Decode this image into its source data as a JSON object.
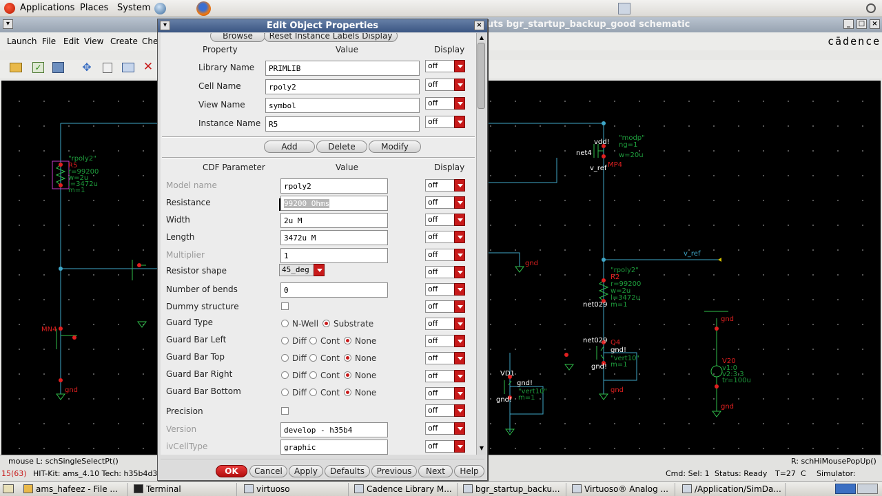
{
  "top_panel": {
    "applications": "Applications",
    "places": "Places",
    "system": "System"
  },
  "schematic_window": {
    "title": "uts bgr_startup_backup_good schematic",
    "menus": [
      "Launch",
      "File",
      "Edit",
      "View",
      "Create",
      "Che"
    ],
    "brand": "cādence",
    "status_left": "mouse L: schSingleSelectPt()",
    "status_right": "R: schHiMouseP­opUp()",
    "status_cmd_count": "15(63)",
    "status_hitkit": "HIT-Kit: ams_4.10  Tech: h35b4d3",
    "status_cmd": "Cmd: Sel: 1",
    "status_ready": "Status: Ready",
    "status_temp": "T=27",
    "status_c": "C",
    "status_sim": "Simulator: spectre"
  },
  "schematic_labels": [
    "\"rpoly2\"",
    "R5",
    "r=99200",
    "w=2u",
    "l=3472u",
    "m=1",
    "\"modp\"",
    "ng=1",
    "vdd!",
    "net4",
    "v_ref",
    "MP4",
    "w=20u",
    "v_ref",
    "\"rpoly2\"",
    "R2",
    "r=99200",
    "w=2u",
    "l=3472u",
    "m=1",
    "net029",
    "net029",
    "Q4",
    "gnd!",
    "\"vert10\"",
    "m=1",
    "gnd!",
    "VD1",
    "gnd!",
    "\"vert10\"",
    "m=1",
    "gnd!",
    "V20",
    "v1:0",
    "v2:3.3",
    "tr=100u",
    "gnd",
    "gnd",
    "gnd",
    "gnd",
    "MN4",
    "gnd"
  ],
  "dialog": {
    "title": "Edit Object Properties",
    "top_buttons": {
      "browse": "Browse",
      "reset": "Reset Instance Labels Display"
    },
    "headers": {
      "property": "Property",
      "value": "Value",
      "display": "Display",
      "cdf": "CDF Parameter"
    },
    "props": [
      {
        "label": "Library Name",
        "value": "PRIMLIB",
        "display": "off"
      },
      {
        "label": "Cell Name",
        "value": "rpoly2",
        "display": "off"
      },
      {
        "label": "View Name",
        "value": "symbol",
        "display": "off"
      },
      {
        "label": "Instance Name",
        "value": "R5",
        "display": "off"
      }
    ],
    "mid_buttons": {
      "add": "Add",
      "delete": "Delete",
      "modify": "Modify"
    },
    "cdf": [
      {
        "label": "Model name",
        "value": "rpoly2",
        "display": "off"
      },
      {
        "label": "Resistance",
        "value": "99200 Ohms",
        "display": "off"
      },
      {
        "label": "Width",
        "value": "2u M",
        "display": "off"
      },
      {
        "label": "Length",
        "value": "3472u M",
        "display": "off"
      },
      {
        "label": "Multiplier",
        "value": "1",
        "display": "off"
      },
      {
        "label": "Resistor shape",
        "value": "45_deg",
        "display": "off"
      },
      {
        "label": "Number of bends",
        "value": "0",
        "display": "off"
      },
      {
        "label": "Dummy structure",
        "value": "",
        "display": "off"
      },
      {
        "label": "Guard Type",
        "value": "",
        "display": "off"
      },
      {
        "label": "Guard Bar Left",
        "value": "",
        "display": "off"
      },
      {
        "label": "Guard Bar Top",
        "value": "",
        "display": "off"
      },
      {
        "label": "Guard Bar Right",
        "value": "",
        "display": "off"
      },
      {
        "label": "Guard Bar Bottom",
        "value": "",
        "display": "off"
      },
      {
        "label": "Precision",
        "value": "",
        "display": "off"
      },
      {
        "label": "Version",
        "value": "develop - h35b4",
        "display": "off"
      },
      {
        "label": "ivCellType",
        "value": "graphic",
        "display": "off"
      }
    ],
    "guard_type_opts": {
      "nwell": "N-Well",
      "substrate": "Substrate"
    },
    "guard_opts": {
      "diff": "Diff",
      "cont": "Cont",
      "none": "None"
    },
    "bottom_buttons": {
      "ok": "OK",
      "cancel": "Cancel",
      "apply": "Apply",
      "defaults": "Defaults",
      "previous": "Previous",
      "next": "Next",
      "help": "Help"
    }
  },
  "taskbar": [
    "ams_hafeez - File ...",
    "Terminal",
    "virtuoso",
    "Cadence Library M...",
    "bgr_startup_backu...",
    "Virtuoso® Analog ...",
    "/Application/SimDa..."
  ]
}
